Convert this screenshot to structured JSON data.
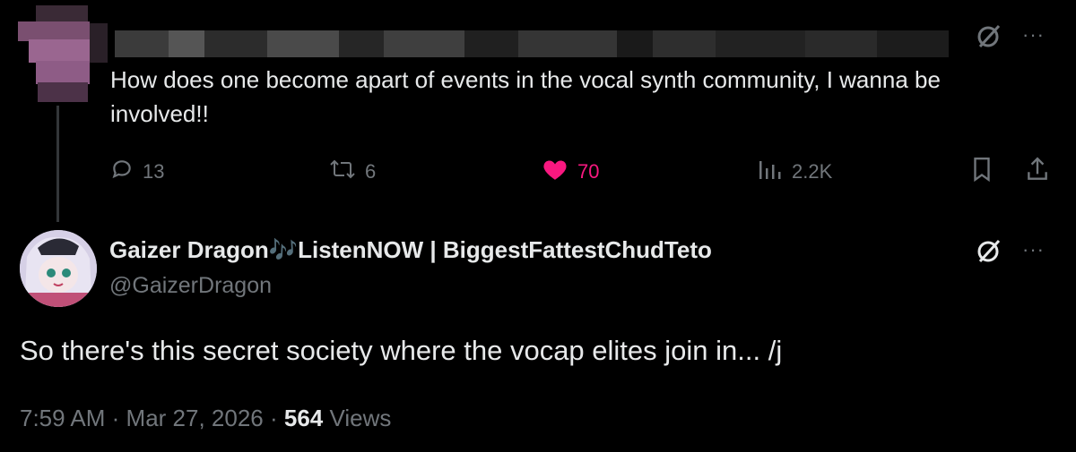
{
  "parent": {
    "text": "How does one become apart of events in the vocal synth community, I wanna be involved!!",
    "stats": {
      "replies": "13",
      "reposts": "6",
      "likes": "70",
      "views": "2.2K"
    }
  },
  "reply": {
    "display_name": "Gaizer Dragon🎶ListenNOW | BiggestFattestChudTeto",
    "handle": "@GaizerDragon",
    "text": "So there's this secret society where the vocap elites join in... /j",
    "time": "7:59 AM",
    "date": "Mar 27, 2026",
    "views_count": "564",
    "views_label": "Views"
  },
  "colors": {
    "background": "#000000",
    "text": "#e7e9ea",
    "muted": "#71767b",
    "like": "#f91880"
  },
  "icons": [
    "grok-icon",
    "more-icon",
    "reply-icon",
    "repost-icon",
    "heart-icon",
    "analytics-icon",
    "bookmark-icon",
    "share-icon"
  ]
}
